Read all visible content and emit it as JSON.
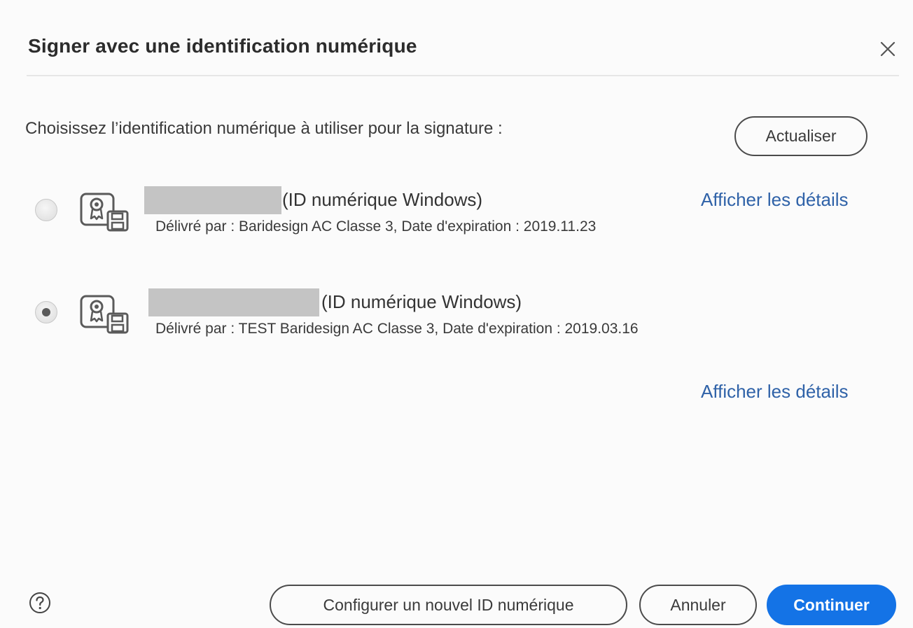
{
  "dialog": {
    "title": "Signer avec une identification numérique",
    "close_icon": "close-icon",
    "prompt": "Choisissez l’identification numérique à utiliser pour la signature :",
    "refresh_label": "Actualiser"
  },
  "ids": [
    {
      "type": "(ID numérique Windows)",
      "issuer_line": "Délivré par : Baridesign AC Classe 3, Date d'expiration : 2019.11.23",
      "selected": false,
      "icon": "certificate-icon"
    },
    {
      "type": "(ID numérique Windows)",
      "issuer_line": "Délivré par : TEST Baridesign AC Classe 3, Date d'expiration : 2019.03.16",
      "selected": true,
      "icon": "certificate-icon"
    }
  ],
  "links": {
    "details_1": "Afficher les détails",
    "details_2": "Afficher les détails"
  },
  "footer": {
    "help_icon": "help-icon",
    "configure_label": "Configurer un nouvel ID numérique",
    "cancel_label": "Annuler",
    "continue_label": "Continuer"
  },
  "colors": {
    "accent": "#1473e6",
    "link": "#2f62a8",
    "redaction": "#c4c4c4"
  }
}
